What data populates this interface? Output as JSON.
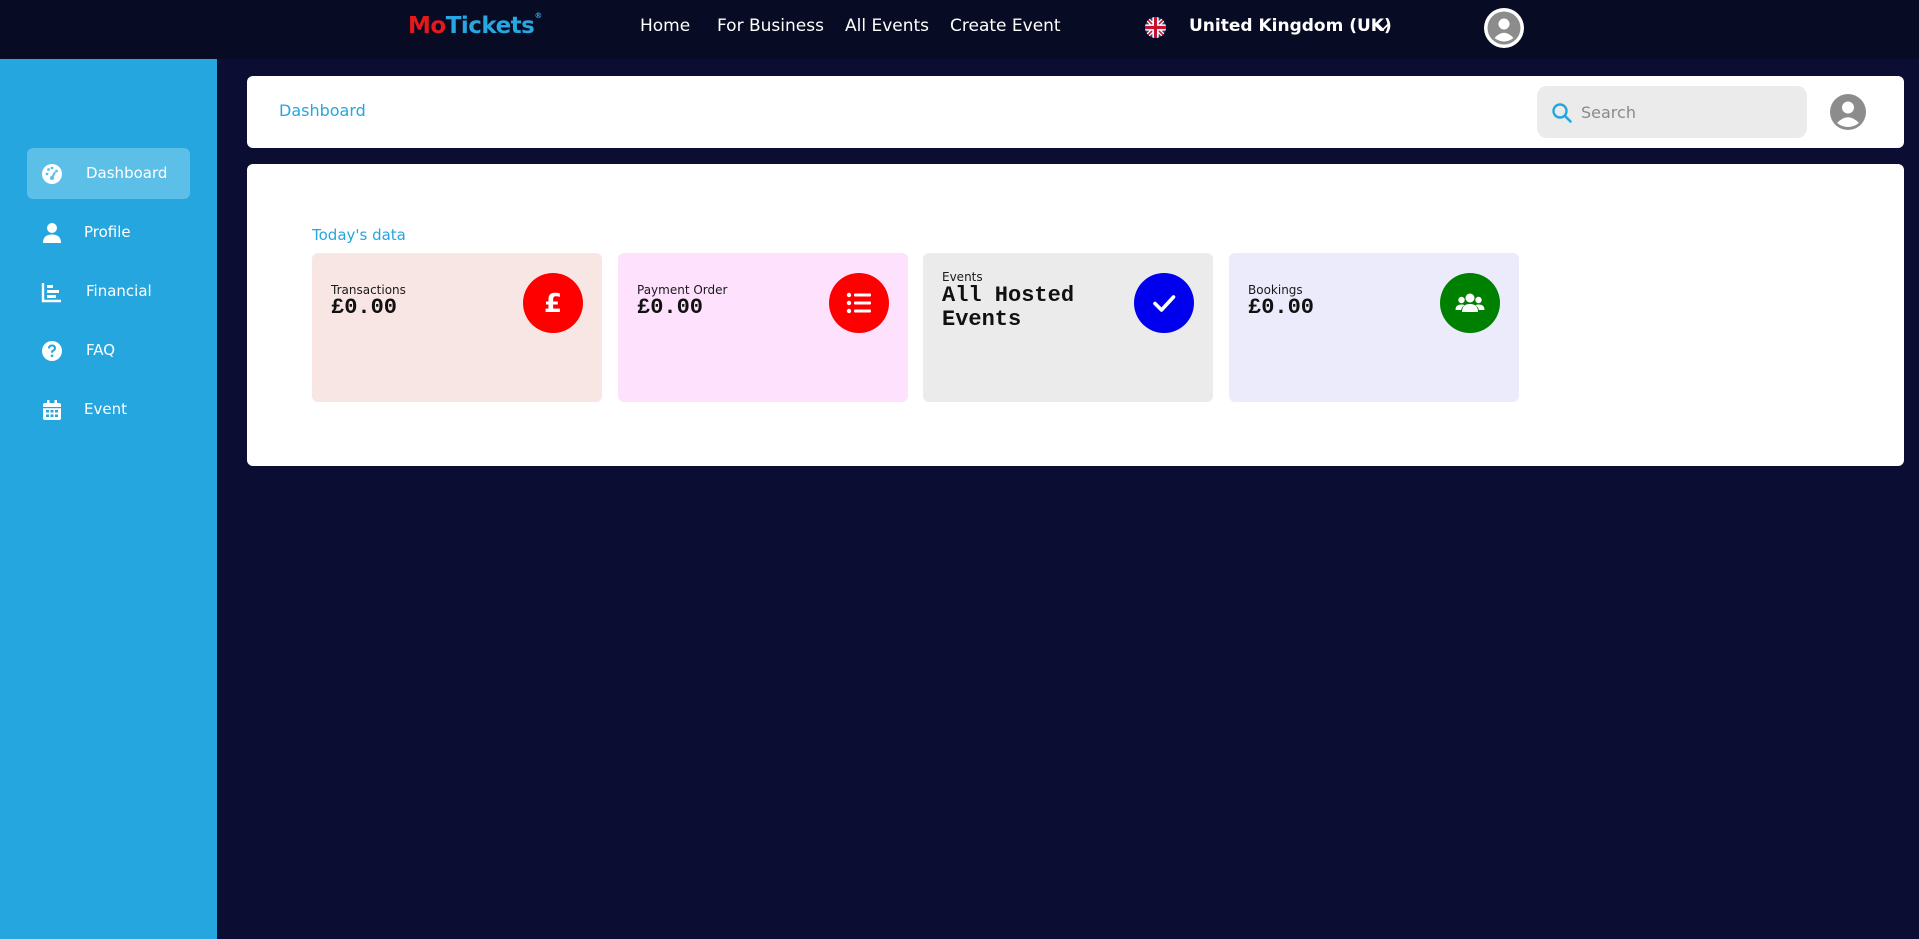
{
  "topbar": {
    "logo_mo": "Mo",
    "logo_tickets": "Tickets",
    "logo_mark": "®",
    "nav": [
      {
        "label": "Home"
      },
      {
        "label": "For Business"
      },
      {
        "label": "All Events"
      },
      {
        "label": "Create Event"
      }
    ],
    "country": "United Kingdom (UK)"
  },
  "sidebar": {
    "items": [
      {
        "label": "Dashboard",
        "icon": "dashboard-gauge-icon",
        "active": true
      },
      {
        "label": "Profile",
        "icon": "user-icon"
      },
      {
        "label": "Financial",
        "icon": "chart-icon"
      },
      {
        "label": "FAQ",
        "icon": "question-circle-icon"
      },
      {
        "label": "Event",
        "icon": "calendar-icon"
      }
    ]
  },
  "header": {
    "breadcrumb": "Dashboard",
    "search_placeholder": "Search"
  },
  "main": {
    "section_title": "Today's data",
    "stats": [
      {
        "label": "Transactions",
        "value": "£0.00",
        "icon": "pound-icon",
        "bg": "#f8e6e4",
        "badge": "#ff0000"
      },
      {
        "label": "Payment Order",
        "value": "£0.00",
        "icon": "list-icon",
        "bg": "#fde1fd",
        "badge": "#ff0000"
      },
      {
        "label": "Events",
        "value": "All Hosted Events",
        "icon": "check-icon",
        "bg": "#ebebeb",
        "badge": "#0000ee"
      },
      {
        "label": "Bookings",
        "value": "£0.00",
        "icon": "users-icon",
        "bg": "#ebebfc",
        "badge": "#008000"
      }
    ]
  },
  "colors": {
    "page_bg": "#0b0d33",
    "topbar_bg": "#070c24",
    "sidebar_bg": "#25a6df",
    "accent": "#25a6df"
  }
}
